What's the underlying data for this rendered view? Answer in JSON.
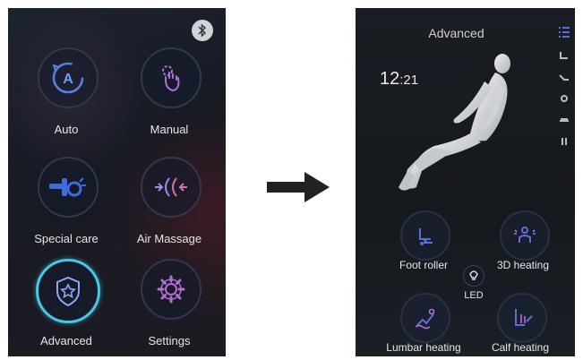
{
  "left_screen": {
    "menu": [
      {
        "label": "Auto",
        "icon": "auto-a-icon"
      },
      {
        "label": "Manual",
        "icon": "hand-gear-icon"
      },
      {
        "label": "Special care",
        "icon": "special-care-icon"
      },
      {
        "label": "Air Massage",
        "icon": "air-massage-icon"
      },
      {
        "label": "Advanced",
        "icon": "shield-star-icon",
        "active": true
      },
      {
        "label": "Settings",
        "icon": "gear-icon"
      }
    ],
    "bluetooth_icon": "bluetooth-icon"
  },
  "right_screen": {
    "title": "Advanced",
    "clock_hours": "12",
    "clock_minutes": ":21",
    "functions": [
      {
        "label": "Foot roller",
        "icon": "foot-roller-icon"
      },
      {
        "label": "3D heating",
        "icon": "3d-heating-icon"
      },
      {
        "label": "Lumbar heating",
        "icon": "lumbar-heating-icon"
      },
      {
        "label": "Calf heating",
        "icon": "calf-heating-icon"
      }
    ],
    "led_label": "LED"
  },
  "colors": {
    "accent": "#46c7e6",
    "icon_blue": "#5b6fd6",
    "icon_pink": "#b070d8"
  }
}
